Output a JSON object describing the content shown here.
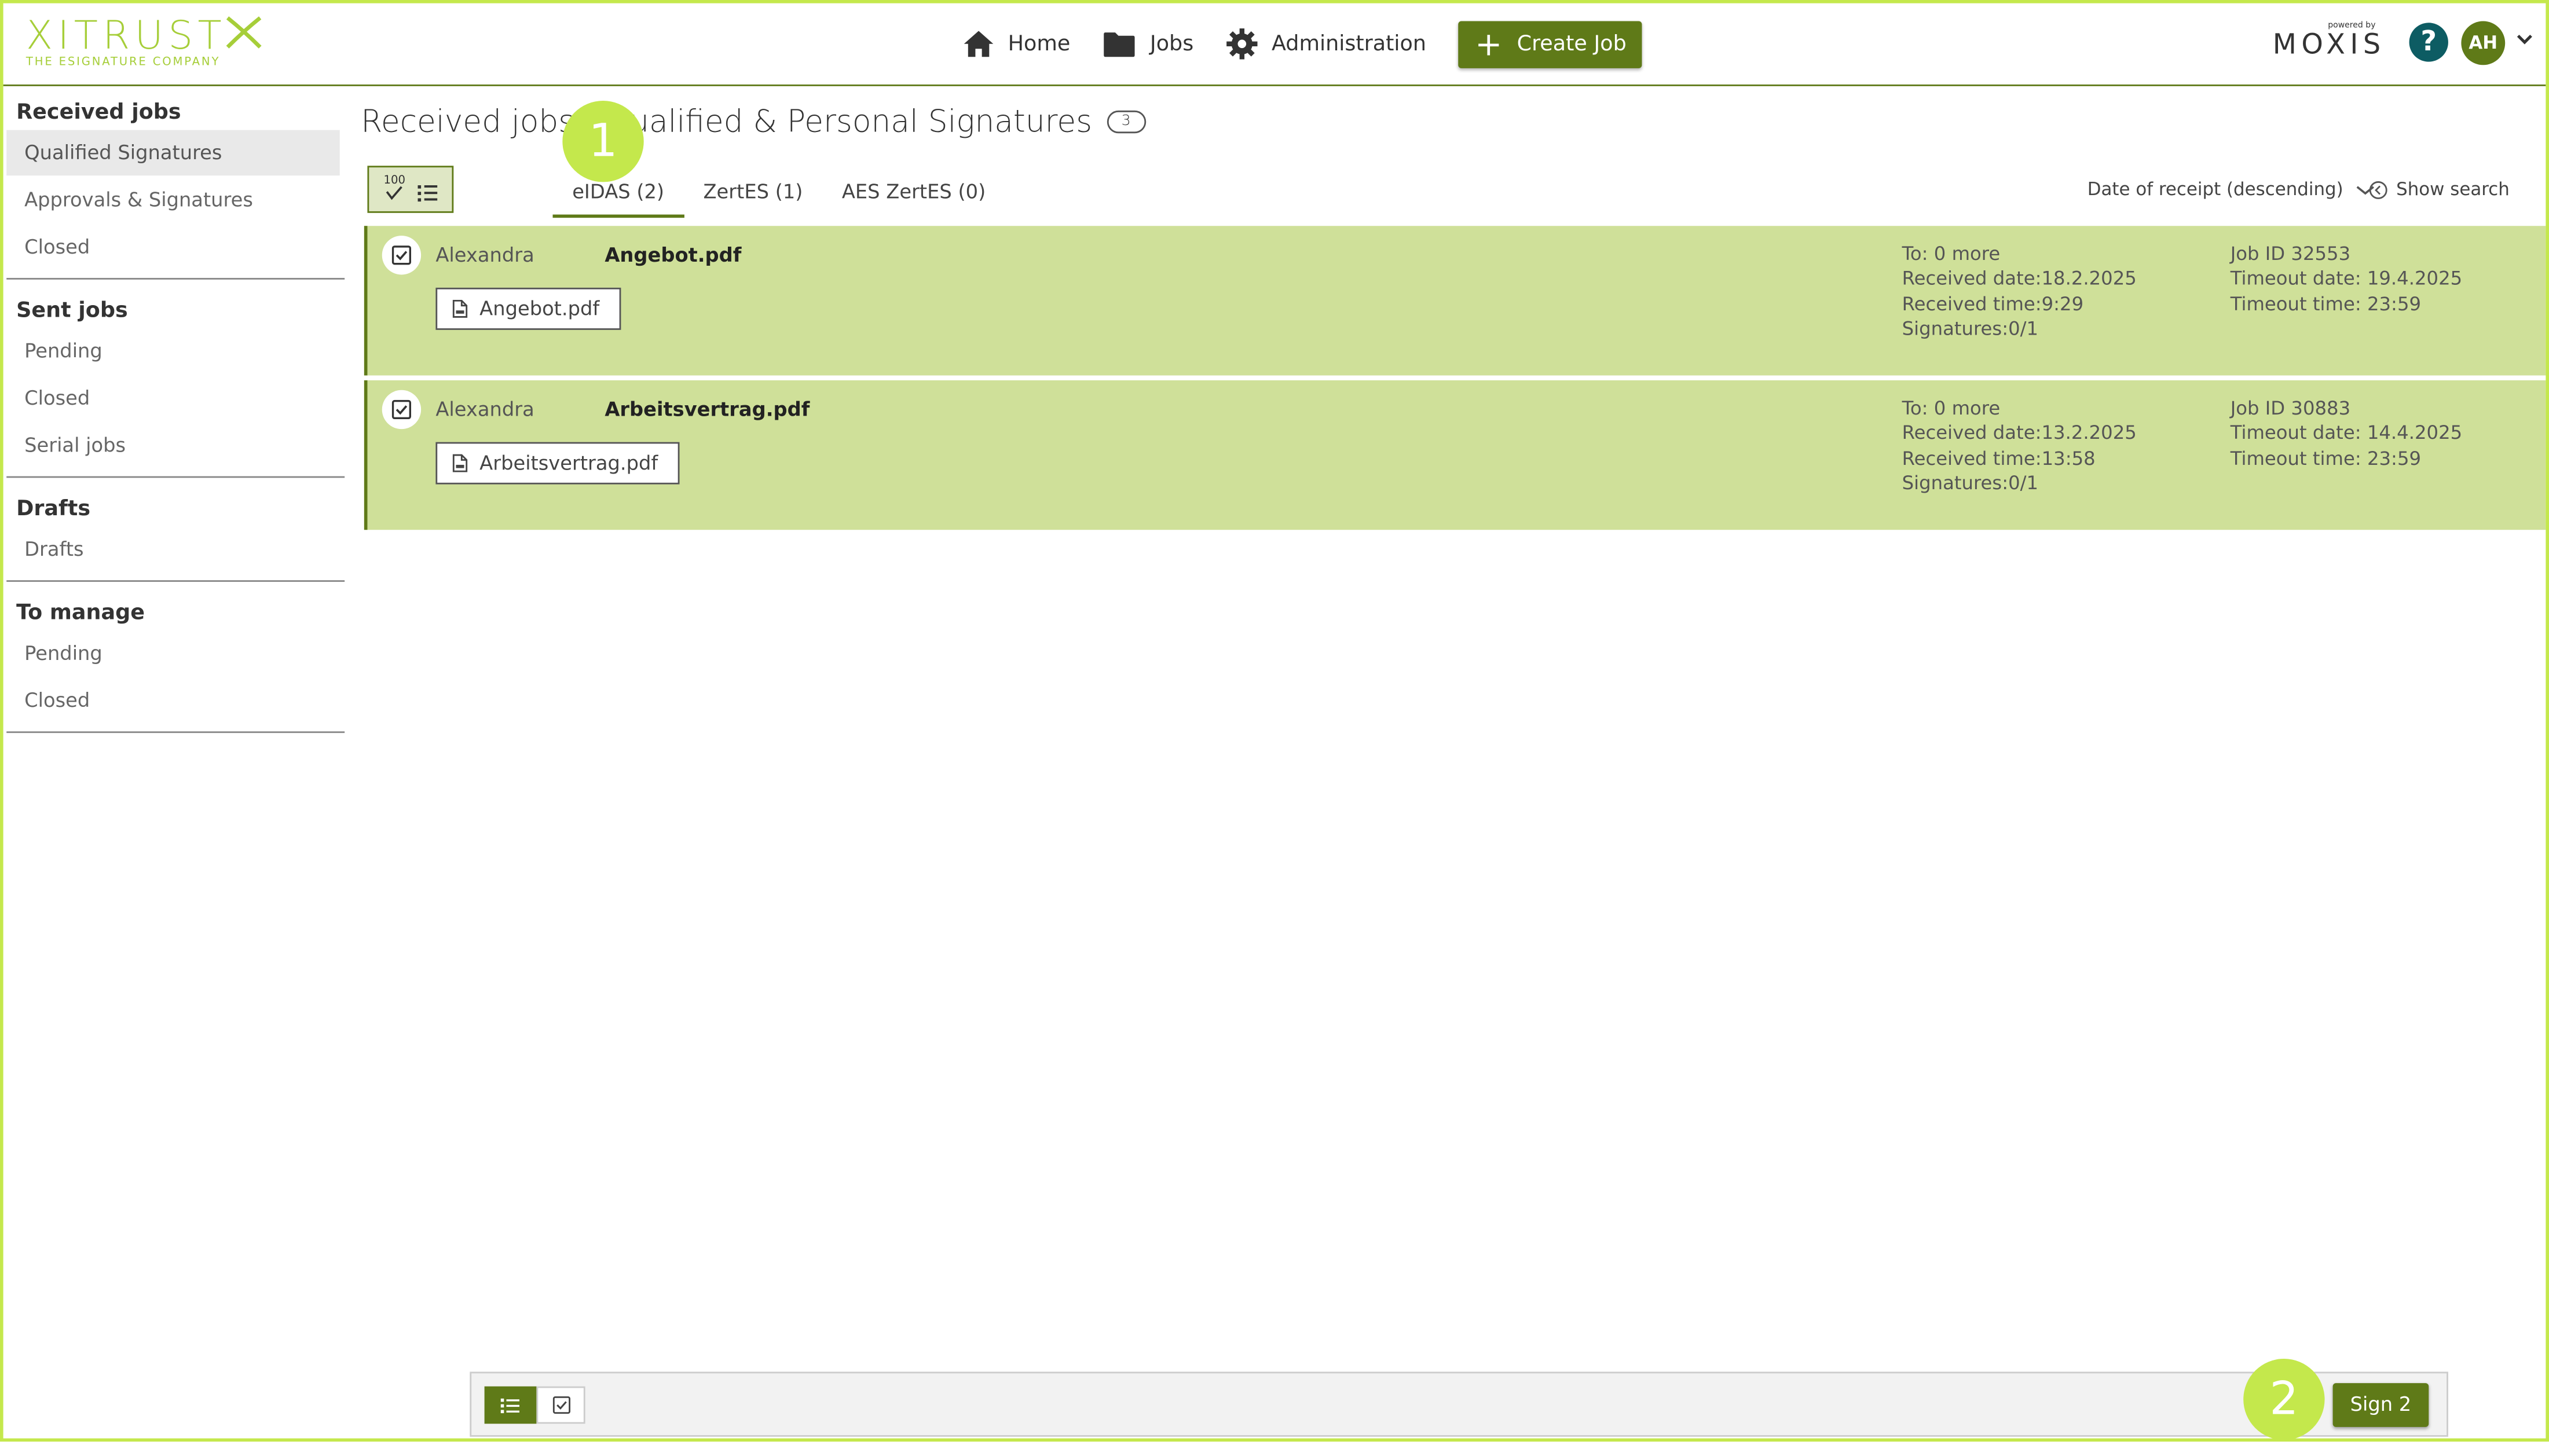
{
  "header": {
    "logo_word": "XITRUST",
    "logo_tagline": "THE ESIGNATURE COMPANY",
    "nav": {
      "home": "Home",
      "jobs": "Jobs",
      "administration": "Administration",
      "create_job": "Create Job"
    },
    "brand_powered": "powered by",
    "brand_word": "MOXIS",
    "help_glyph": "?",
    "avatar_initials": "AH"
  },
  "sidebar": {
    "groups": [
      {
        "heading": "Received jobs",
        "items": [
          "Qualified Signatures",
          "Approvals & Signatures",
          "Closed"
        ],
        "active": 0
      },
      {
        "heading": "Sent jobs",
        "items": [
          "Pending",
          "Closed",
          "Serial jobs"
        ]
      },
      {
        "heading": "Drafts",
        "items": [
          "Drafts"
        ]
      },
      {
        "heading": "To manage",
        "items": [
          "Pending",
          "Closed"
        ]
      }
    ]
  },
  "main": {
    "title": "Received jobs - Qualified & Personal Signatures",
    "count": "3",
    "select_all_badge": "100",
    "tabs": [
      "eIDAS (2)",
      "ZertES (1)",
      "AES ZertES (0)"
    ],
    "active_tab": 0,
    "sort_label": "Date of receipt (descending)",
    "show_search": "Show search",
    "jobs": [
      {
        "sender": "Alexandra",
        "title": "Angebot.pdf",
        "document": "Angebot.pdf",
        "to": "To: 0 more",
        "received_date": "Received date:18.2.2025",
        "received_time": "Received time:9:29",
        "signatures": "Signatures:0/1",
        "job_id": "Job ID 32553",
        "timeout_date": "Timeout date: 19.4.2025",
        "timeout_time": "Timeout time: 23:59"
      },
      {
        "sender": "Alexandra",
        "title": "Arbeitsvertrag.pdf",
        "document": "Arbeitsvertrag.pdf",
        "to": "To: 0 more",
        "received_date": "Received date:13.2.2025",
        "received_time": "Received time:13:58",
        "signatures": "Signatures:0/1",
        "job_id": "Job ID 30883",
        "timeout_date": "Timeout date: 14.4.2025",
        "timeout_time": "Timeout time: 23:59"
      }
    ]
  },
  "bottom_bar": {
    "sign_label": "Sign 2"
  },
  "callouts": {
    "one": "1",
    "two": "2"
  },
  "colors": {
    "accent": "#5f7a18",
    "row_selected": "#cfe099",
    "frame": "#c4e84c",
    "help": "#0d5c63"
  }
}
